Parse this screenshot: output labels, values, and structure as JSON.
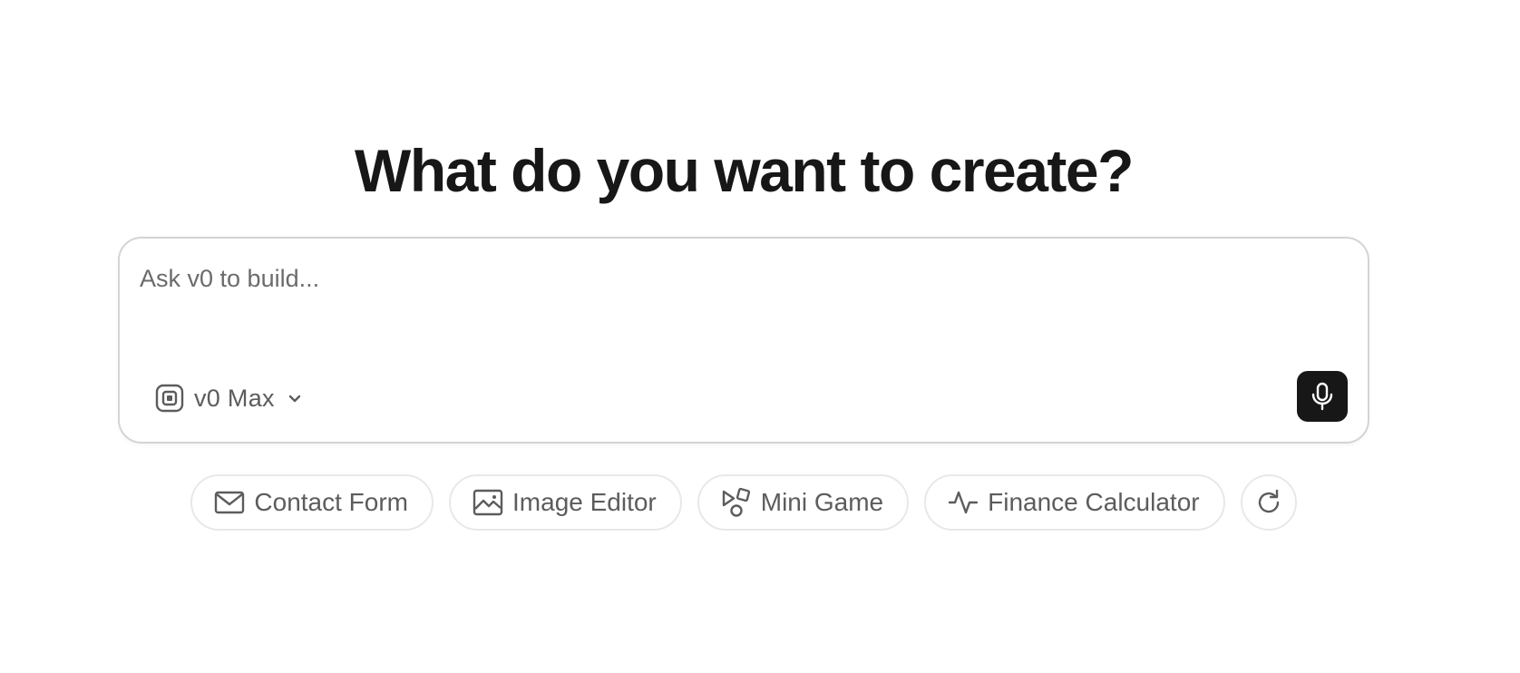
{
  "heading": "What do you want to create?",
  "prompt": {
    "placeholder": "Ask v0 to build...",
    "value": ""
  },
  "model_selector": {
    "icon": "model-chip-icon",
    "label": "v0 Max",
    "dropdown_icon": "chevron-down-icon"
  },
  "mic_button": {
    "icon": "microphone-icon",
    "background": "#171717"
  },
  "suggestions": [
    {
      "label": "Contact Form",
      "icon": "mail-icon"
    },
    {
      "label": "Image Editor",
      "icon": "image-icon"
    },
    {
      "label": "Mini Game",
      "icon": "shapes-icon"
    },
    {
      "label": "Finance Calculator",
      "icon": "activity-icon"
    }
  ],
  "refresh_button": {
    "icon": "refresh-icon"
  },
  "colors": {
    "text_primary": "#171717",
    "text_secondary": "#5c5c5c",
    "border": "#d4d4d4",
    "chip_border": "#e8e8e8"
  }
}
